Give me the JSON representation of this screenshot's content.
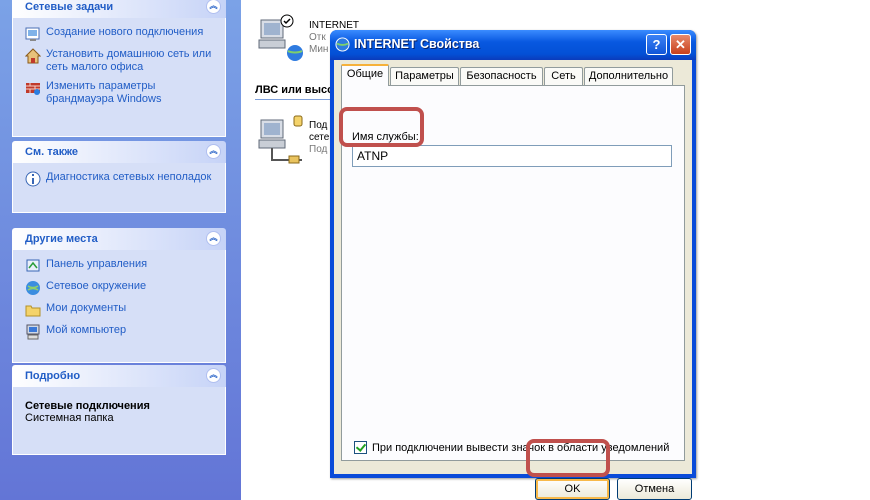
{
  "task_pane": {
    "network_tasks": {
      "title": "Сетевые задачи",
      "items": [
        {
          "label": "Создание нового подключения",
          "icon": "new-connection-icon"
        },
        {
          "label": "Установить домашнюю сеть или сеть малого офиса",
          "icon": "home-network-icon"
        },
        {
          "label": "Изменить параметры брандмауэра Windows",
          "icon": "firewall-icon"
        }
      ]
    },
    "see_also": {
      "title": "См. также",
      "items": [
        {
          "label": "Диагностика сетевых неполадок",
          "icon": "info-icon"
        }
      ]
    },
    "other_places": {
      "title": "Другие места",
      "items": [
        {
          "label": "Панель управления",
          "icon": "control-panel-icon"
        },
        {
          "label": "Сетевое окружение",
          "icon": "network-places-icon"
        },
        {
          "label": "Мои документы",
          "icon": "my-documents-icon"
        },
        {
          "label": "Мой компьютер",
          "icon": "my-computer-icon"
        }
      ]
    },
    "details": {
      "title": "Подробно",
      "name": "Сетевые подключения",
      "type": "Системная папка"
    }
  },
  "main": {
    "internet_conn": {
      "name": "INTERNET",
      "line2": "Отк",
      "line3": "Мин"
    },
    "group_header": "ЛВС или высо",
    "lan_conn": {
      "line1": "Под",
      "line2": "сете",
      "line3": "Под"
    }
  },
  "dialog": {
    "title": "INTERNET Свойства",
    "help": "?",
    "close": "✕",
    "tabs": [
      "Общие",
      "Параметры",
      "Безопасность",
      "Сеть",
      "Дополнительно"
    ],
    "active_tab": "Общие",
    "service_label": "Имя службы:",
    "service_value": "ATNP",
    "notify_label": "При подключении вывести значок в области уведомлений",
    "notify_checked": true,
    "ok": "OK",
    "cancel": "Отмена"
  },
  "colors": {
    "highlight": "#c0504d",
    "titlebar": "#0858e0",
    "taskpane": "#7ba2e7",
    "link": "#215dc6"
  }
}
